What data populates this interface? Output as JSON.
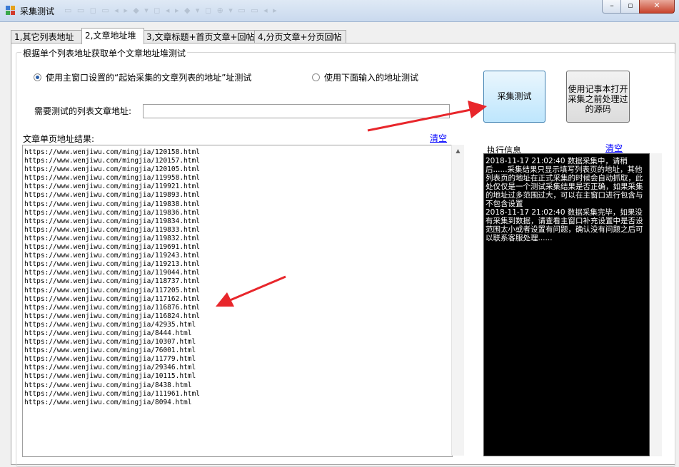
{
  "window": {
    "title": "采集测试"
  },
  "tabs": [
    {
      "label": "1,其它列表地址"
    },
    {
      "label": "2,文章地址堆"
    },
    {
      "label": "3,文章标题+首页文章+回帖"
    },
    {
      "label": "4,分页文章+分页回帖"
    }
  ],
  "group": {
    "title": "根据单个列表地址获取单个文章地址堆测试"
  },
  "options": {
    "radio_main": "使用主窗口设置的“起始采集的文章列表的地址”址测试",
    "radio_below": "使用下面输入的地址测试",
    "selected": "radio_main"
  },
  "url_field": {
    "label": "需要测试的列表文章地址:",
    "value": ""
  },
  "buttons": {
    "collect_test": "采集测试",
    "open_notepad": "使用记事本打开采集之前处理过的源码"
  },
  "results": {
    "label": "文章单页地址结果:",
    "clear": "清空",
    "lines": [
      "https://www.wenjiwu.com/mingjia/120158.html",
      "https://www.wenjiwu.com/mingjia/120157.html",
      "https://www.wenjiwu.com/mingjia/120105.html",
      "https://www.wenjiwu.com/mingjia/119958.html",
      "https://www.wenjiwu.com/mingjia/119921.html",
      "https://www.wenjiwu.com/mingjia/119893.html",
      "https://www.wenjiwu.com/mingjia/119838.html",
      "https://www.wenjiwu.com/mingjia/119836.html",
      "https://www.wenjiwu.com/mingjia/119834.html",
      "https://www.wenjiwu.com/mingjia/119833.html",
      "https://www.wenjiwu.com/mingjia/119832.html",
      "https://www.wenjiwu.com/mingjia/119691.html",
      "https://www.wenjiwu.com/mingjia/119243.html",
      "https://www.wenjiwu.com/mingjia/119213.html",
      "https://www.wenjiwu.com/mingjia/119044.html",
      "https://www.wenjiwu.com/mingjia/118737.html",
      "https://www.wenjiwu.com/mingjia/117205.html",
      "https://www.wenjiwu.com/mingjia/117162.html",
      "https://www.wenjiwu.com/mingjia/116876.html",
      "https://www.wenjiwu.com/mingjia/116824.html",
      "https://www.wenjiwu.com/mingjia/42935.html",
      "https://www.wenjiwu.com/mingjia/8444.html",
      "https://www.wenjiwu.com/mingjia/10307.html",
      "https://www.wenjiwu.com/mingjia/76001.html",
      "https://www.wenjiwu.com/mingjia/11779.html",
      "https://www.wenjiwu.com/mingjia/29346.html",
      "https://www.wenjiwu.com/mingjia/10115.html",
      "https://www.wenjiwu.com/mingjia/8438.html",
      "https://www.wenjiwu.com/mingjia/111961.html",
      "https://www.wenjiwu.com/mingjia/8094.html"
    ]
  },
  "info": {
    "label": "执行信息",
    "clear": "清空",
    "messages": [
      "2018-11-17 21:02:40  数据采集中，请稍后......采集结果只显示填写列表页的地址，其他列表页的地址在正式采集的时候会自动抓取，此处仅仅是一个测试采集结果是否正确，如果采集的地址过多范围过大，可以在主窗口进行包含与不包含设置",
      "2018-11-17 21:02:40  数据采集完毕，如果没有采集到数据，请查看主窗口补充设置中是否设范围太小或者设置有问题，确认没有问题之后可以联系客服处理......"
    ]
  },
  "colors": {
    "accent": "#2a5ea8",
    "arrow": "#e8262b",
    "link": "#0000ff",
    "info_bg": "#000000"
  }
}
